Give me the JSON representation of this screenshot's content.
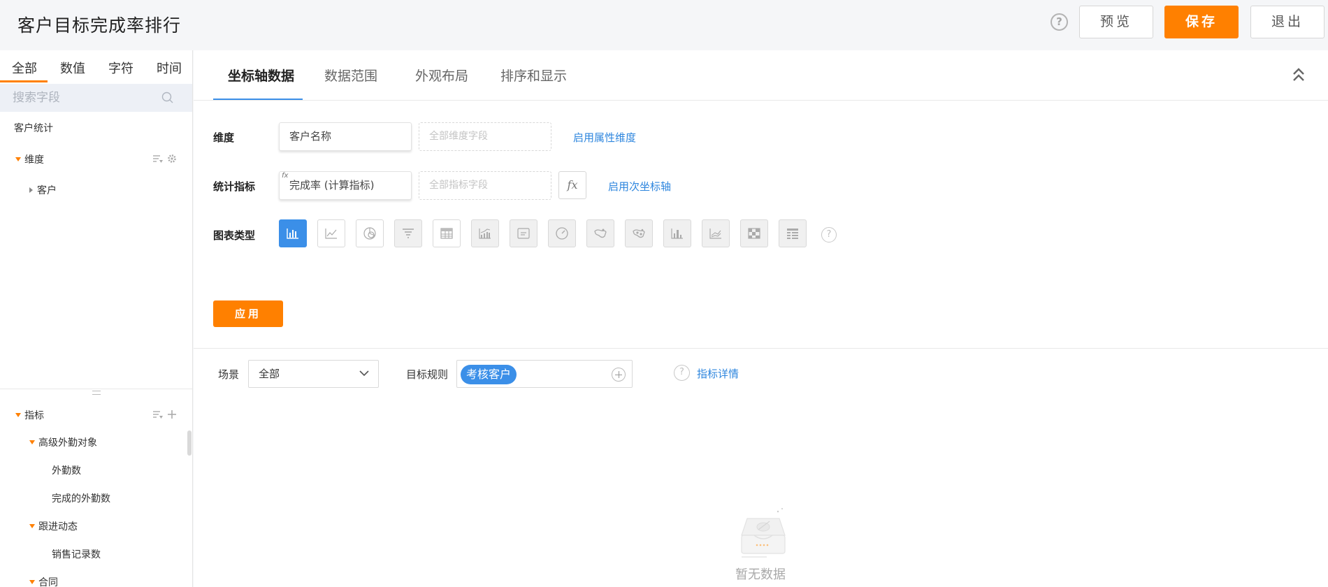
{
  "header": {
    "title": "客户目标完成率排行",
    "help_icon": "question-circle-icon",
    "preview_label": "预览",
    "save_label": "保存",
    "exit_label": "退出"
  },
  "sidebar": {
    "type_tabs": [
      "全部",
      "数值",
      "字符",
      "时间"
    ],
    "search": {
      "placeholder": "搜索字段",
      "value": ""
    },
    "dataset_name": "客户统计",
    "dimension": {
      "label": "维度",
      "items": [
        "客户"
      ]
    },
    "metric": {
      "label": "指标",
      "groups": [
        {
          "label": "高级外勤对象",
          "items": [
            "外勤数",
            "完成的外勤数"
          ]
        },
        {
          "label": "跟进动态",
          "items": [
            "销售记录数"
          ]
        },
        {
          "label": "合同",
          "items": []
        }
      ]
    }
  },
  "main": {
    "tabs": [
      "坐标轴数据",
      "数据范围",
      "外观布局",
      "排序和显示"
    ],
    "active_tab": "坐标轴数据",
    "dimension_row": {
      "label": "维度",
      "field": "客户名称",
      "drop_placeholder": "全部维度字段",
      "link": "启用属性维度"
    },
    "metric_row": {
      "label": "统计指标",
      "fx_tag": "fx",
      "field": "完成率 (计算指标)",
      "drop_placeholder": "全部指标字段",
      "fx_button": "fx",
      "link": "启用次坐标轴"
    },
    "chart_type_row": {
      "label": "图表类型",
      "types": [
        "bar-chart-icon",
        "line-chart-icon",
        "pie-chart-icon",
        "funnel-chart-icon",
        "table-chart-icon",
        "area-chart-icon",
        "card-chart-icon",
        "gauge-chart-icon",
        "map-chart-icon",
        "scatter-chart-icon",
        "combo-bar-chart-icon",
        "multi-line-chart-icon",
        "heatmap-chart-icon",
        "pivot-table-icon"
      ],
      "selected": "bar-chart-icon",
      "help": "?"
    },
    "apply_label": "应用",
    "filters": {
      "scene_label": "场景",
      "scene_value": "全部",
      "rule_label": "目标规则",
      "rule_tag": "考核客户",
      "detail_help": "?",
      "detail_link": "指标详情"
    },
    "empty_text": "暂无数据"
  },
  "colors": {
    "accent_orange": "#ff8000",
    "accent_blue": "#3b8fe8",
    "link_blue": "#2e86de"
  }
}
